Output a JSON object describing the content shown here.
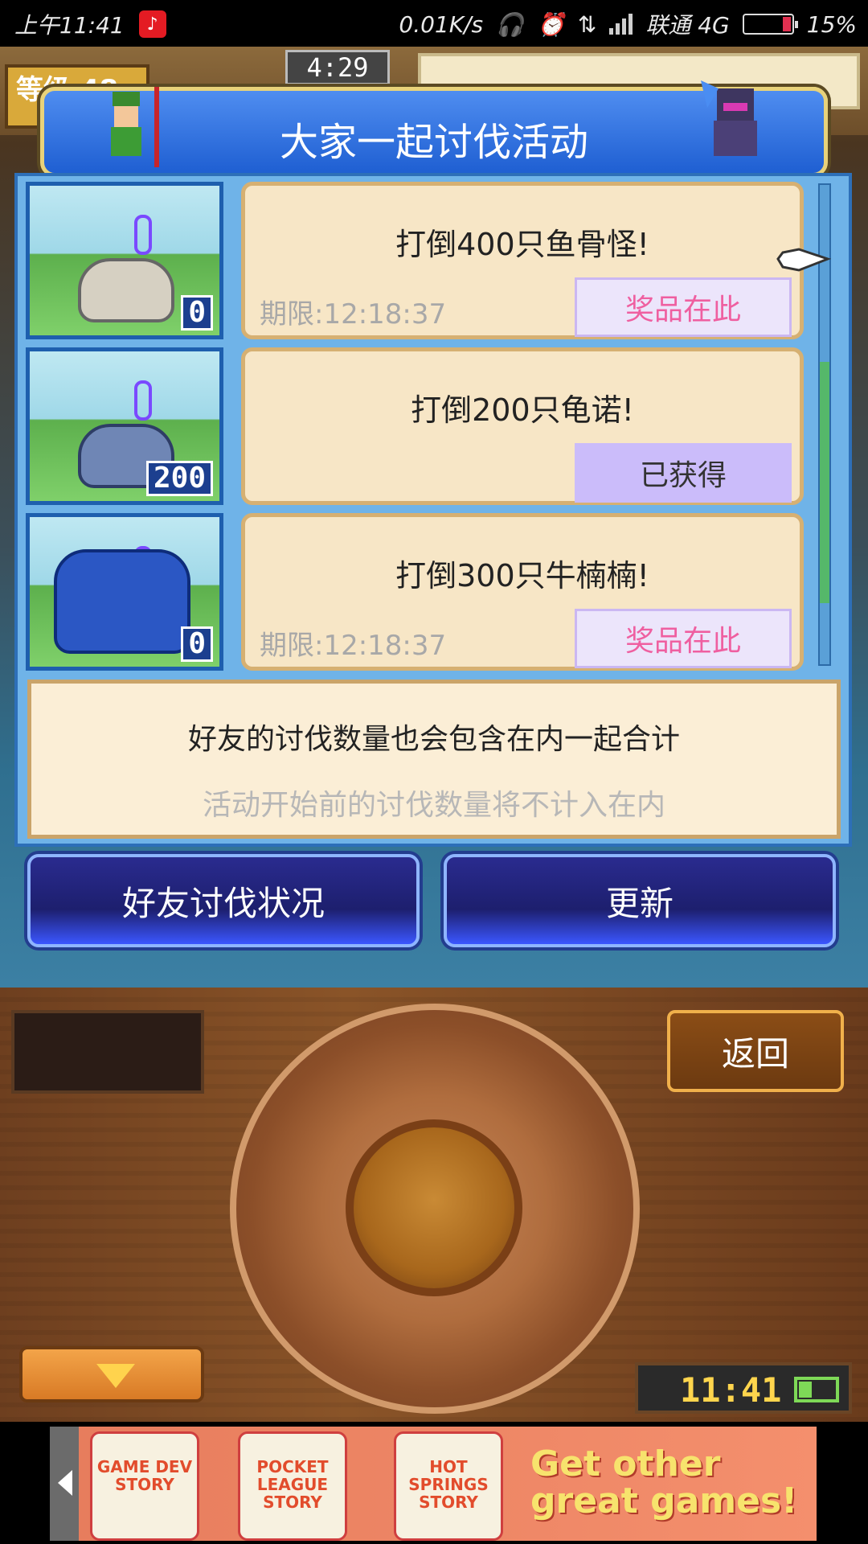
{
  "status_bar": {
    "time": "上午11:41",
    "net_speed": "0.01K/s",
    "carrier": "联通 4G",
    "battery": "15%"
  },
  "game_hud": {
    "level_label": "等级 48",
    "timer": "4:29"
  },
  "dialog": {
    "title": "大家一起讨伐活动",
    "rows": [
      {
        "title": "打倒400只鱼骨怪!",
        "deadline": "期限:12:18:37",
        "action": "奖品在此",
        "count": "0",
        "state": "prize"
      },
      {
        "title": "打倒200只龟诺!",
        "deadline": "",
        "action": "已获得",
        "count": "200",
        "state": "claimed"
      },
      {
        "title": "打倒300只牛楠楠!",
        "deadline": "期限:12:18:37",
        "action": "奖品在此",
        "count": "0",
        "state": "prize"
      }
    ],
    "info_main": "好友的讨伐数量也会包含在内一起合计",
    "info_sub": "活动开始前的讨伐数量将不计入在内"
  },
  "buttons": {
    "friends_status": "好友讨伐状况",
    "refresh": "更新",
    "back": "返回"
  },
  "controller": {
    "clock": "11:41"
  },
  "ad": {
    "tiles": [
      "GAME DEV STORY",
      "POCKET LEAGUE STORY",
      "HOT SPRINGS STORY"
    ],
    "cta": "Get other great games!"
  },
  "colors": {
    "title_blue": "#1f5fd2",
    "panel_blue": "#6fb3e8",
    "card_bg": "#f7e6c6",
    "prize_text": "#ef5fa0",
    "claimed_bg": "#cbbcfa"
  }
}
